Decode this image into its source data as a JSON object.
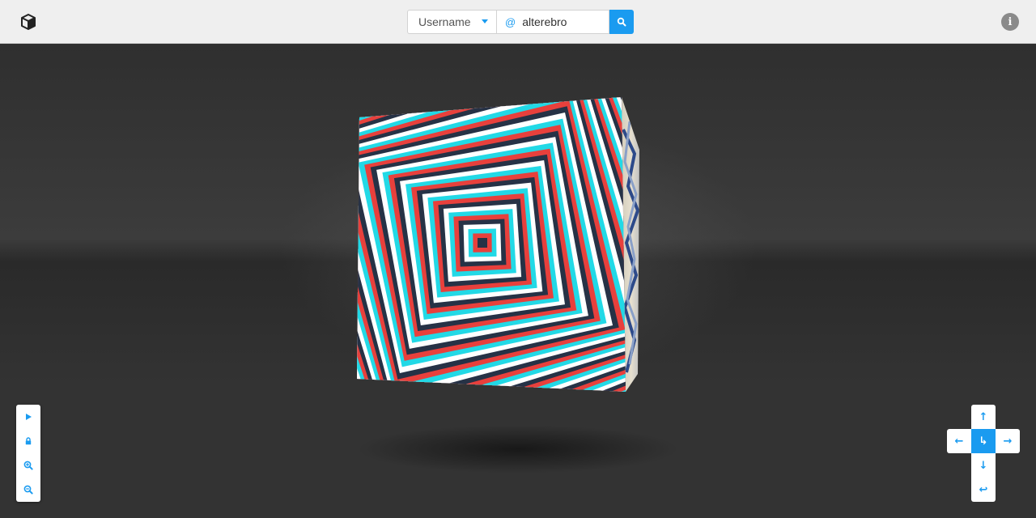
{
  "header": {
    "logo_icon": "cube-icon",
    "search_type": {
      "selected": "Username",
      "options": [
        "Username"
      ]
    },
    "search_prefix": "@",
    "search_value": "alterebro",
    "search_button_icon": "search-icon",
    "info_icon": "info-icon",
    "info_glyph": "i"
  },
  "left_controls": [
    {
      "name": "play-icon"
    },
    {
      "name": "lock-icon"
    },
    {
      "name": "zoom-in-icon"
    },
    {
      "name": "zoom-out-icon"
    }
  ],
  "dpad": {
    "up": "↑",
    "left": "←",
    "center": "↳",
    "right": "→",
    "down": "↓",
    "back": "↩"
  },
  "colors": {
    "accent": "#1a9bf0",
    "topbar": "#efefef",
    "stage": "#333333",
    "stripe_red": "#e8403c",
    "stripe_cyan": "#22d9e6",
    "stripe_navy": "#263246"
  }
}
